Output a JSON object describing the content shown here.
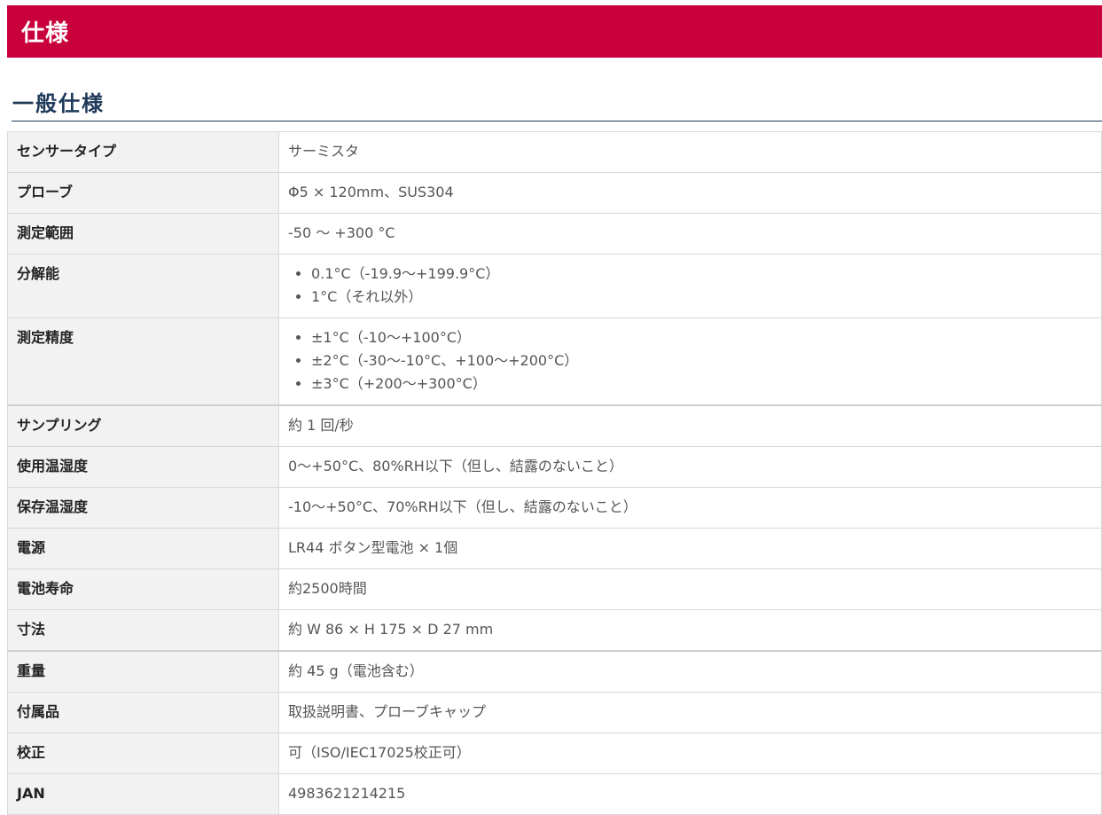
{
  "page_title": "仕様",
  "section_title": "一般仕様",
  "colors": {
    "banner": "#c8003c",
    "heading": "#1f3a5a",
    "label_bg": "#f2f2f2"
  },
  "specs": [
    {
      "label": "センサータイプ",
      "value": "サーミスタ"
    },
    {
      "label": "プローブ",
      "value": "Φ5 × 120mm、SUS304"
    },
    {
      "label": "測定範囲",
      "value": "-50 〜 +300 °C"
    },
    {
      "label": "分解能",
      "items": [
        "0.1°C（-19.9〜+199.9°C）",
        "1°C（それ以外）"
      ]
    },
    {
      "label": "測定精度",
      "items": [
        "±1°C（-10〜+100°C）",
        "±2°C（-30〜-10°C、+100〜+200°C）",
        "±3°C（+200〜+300°C）"
      ]
    },
    {
      "label": "サンプリング",
      "value": "約 1 回/秒"
    },
    {
      "label": "使用温湿度",
      "value": "0〜+50°C、80%RH以下（但し、結露のないこと）"
    },
    {
      "label": "保存温湿度",
      "value": "-10〜+50°C、70%RH以下（但し、結露のないこと）"
    },
    {
      "label": "電源",
      "value": "LR44 ボタン型電池 × 1個"
    },
    {
      "label": "電池寿命",
      "value": "約2500時間"
    },
    {
      "label": "寸法",
      "value": "約 W 86 × H 175 × D 27 mm"
    },
    {
      "label": "重量",
      "value": "約 45 g（電池含む）"
    },
    {
      "label": "付属品",
      "value": "取扱説明書、プローブキャップ"
    },
    {
      "label": "校正",
      "value": "可（ISO/IEC17025校正可）"
    },
    {
      "label": "JAN",
      "value": "4983621214215"
    }
  ]
}
